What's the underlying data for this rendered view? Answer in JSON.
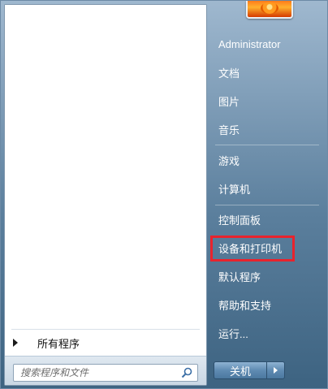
{
  "left": {
    "all_programs_label": "所有程序",
    "search_placeholder": "搜索程序和文件"
  },
  "right": {
    "user": "Administrator",
    "items": [
      {
        "label": "文档"
      },
      {
        "label": "图片"
      },
      {
        "label": "音乐"
      },
      {
        "label": "游戏"
      },
      {
        "label": "计算机"
      },
      {
        "label": "控制面板"
      },
      {
        "label": "设备和打印机"
      },
      {
        "label": "默认程序"
      },
      {
        "label": "帮助和支持"
      },
      {
        "label": "运行..."
      }
    ],
    "highlighted_item": "设备和打印机",
    "shutdown_label": "关机"
  },
  "icons": {
    "all_programs": "arrow-right-icon",
    "search": "magnifier-icon",
    "shutdown_options": "chevron-right-icon",
    "avatar": "flower-picture"
  },
  "colors": {
    "highlight_border": "#e8232d",
    "right_panel": "#5b7f9d"
  }
}
